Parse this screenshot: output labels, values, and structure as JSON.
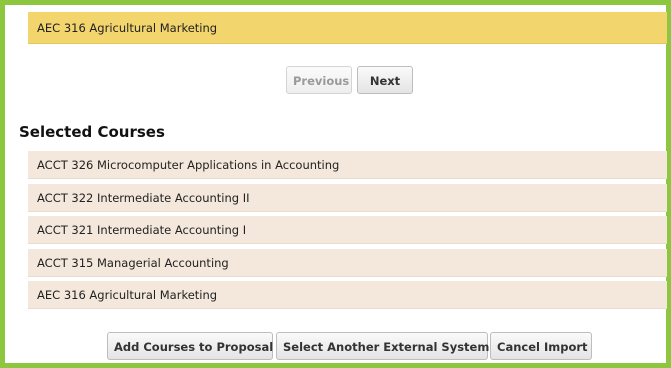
{
  "search_results": {
    "visible_item": "AEC 316 Agricultural Marketing"
  },
  "pagination": {
    "previous_label": "Previous",
    "next_label": "Next",
    "previous_disabled": true
  },
  "selected": {
    "title": "Selected Courses",
    "courses": [
      "ACCT 326 Microcomputer Applications in Accounting",
      "ACCT 322 Intermediate Accounting II",
      "ACCT 321 Intermediate Accounting I",
      "ACCT 315 Managerial Accounting",
      "AEC 316 Agricultural Marketing"
    ]
  },
  "actions": {
    "add_label": "Add Courses to Proposal",
    "select_system_label": "Select Another External System",
    "cancel_label": "Cancel Import"
  },
  "colors": {
    "frame_border": "#8dc63f",
    "highlight_row": "#f3d56e",
    "selected_row": "#f4e8dc"
  }
}
